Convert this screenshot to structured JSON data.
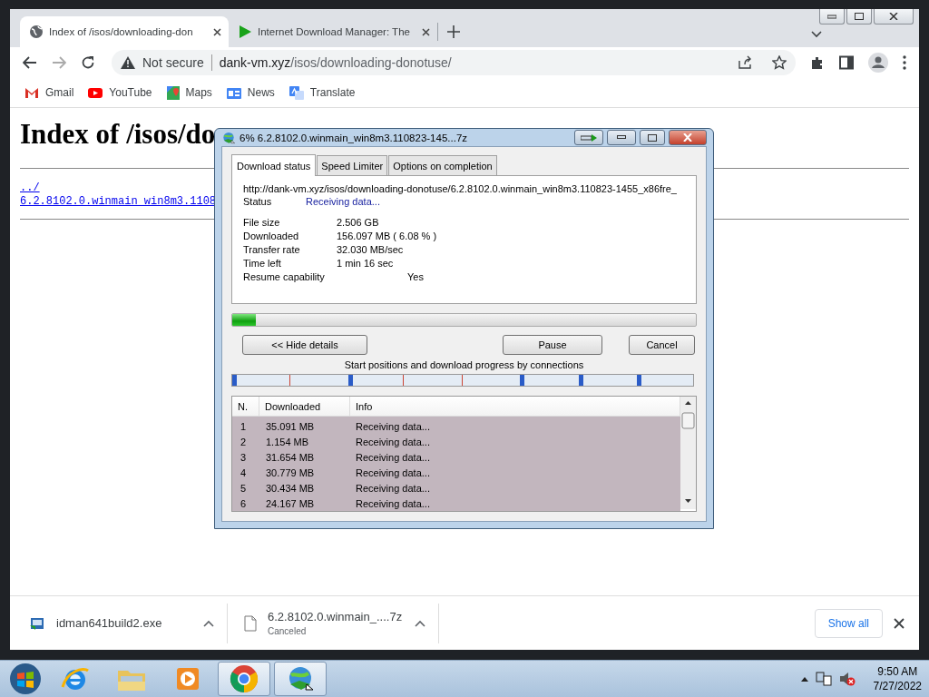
{
  "browser": {
    "tabs": [
      {
        "title": "Index of /isos/downloading-don",
        "selected": true,
        "kind": "globe"
      },
      {
        "title": "Internet Download Manager: The",
        "selected": false,
        "kind": "idm"
      }
    ],
    "address": {
      "security": "Not secure",
      "host": "dank-vm.xyz",
      "path": "/isos/downloading-donotuse/"
    },
    "bookmarks": [
      {
        "label": "Gmail",
        "kind": "gmail"
      },
      {
        "label": "YouTube",
        "kind": "youtube"
      },
      {
        "label": "Maps",
        "kind": "maps"
      },
      {
        "label": "News",
        "kind": "news"
      },
      {
        "label": "Translate",
        "kind": "translate"
      }
    ]
  },
  "page": {
    "heading": "Index of /isos/do",
    "links": [
      "../",
      "6.2.8102.0.winmain_win8m3.1108"
    ]
  },
  "dialog": {
    "title": "6% 6.2.8102.0.winmain_win8m3.110823-145...7z",
    "tabs": [
      {
        "label": "Download status",
        "selected": true
      },
      {
        "label": "Speed Limiter",
        "selected": false
      },
      {
        "label": "Options on completion",
        "selected": false
      }
    ],
    "url": "http://dank-vm.xyz/isos/downloading-donotuse/6.2.8102.0.winmain_win8m3.110823-1455_x86fre_",
    "status": {
      "label": "Status",
      "value": "Receiving data..."
    },
    "details": [
      {
        "label": "File size",
        "value": "2.506  GB"
      },
      {
        "label": "Downloaded",
        "value": "156.097  MB  ( 6.08 % )"
      },
      {
        "label": "Transfer rate",
        "value": "32.030  MB/sec"
      },
      {
        "label": "Time left",
        "value": "1 min  16 sec"
      },
      {
        "label": "Resume capability",
        "value": "Yes"
      }
    ],
    "progress": {
      "level": 0.05
    },
    "buttons": [
      "<< Hide details",
      "Pause",
      "Cancel"
    ],
    "connections_label": "Start positions and download progress by connections",
    "table": {
      "columns": [
        "N.",
        "Downloaded",
        "Info"
      ],
      "rows": [
        [
          "1",
          "35.091  MB",
          "Receiving data..."
        ],
        [
          "2",
          "1.154  MB",
          "Receiving data..."
        ],
        [
          "3",
          "31.654  MB",
          "Receiving data..."
        ],
        [
          "4",
          "30.779  MB",
          "Receiving data..."
        ],
        [
          "5",
          "30.434  MB",
          "Receiving data..."
        ],
        [
          "6",
          "24.167  MB",
          "Receiving data..."
        ]
      ]
    }
  },
  "downloads": {
    "items": [
      {
        "name": "idman641build2.exe",
        "kind": "installer"
      },
      {
        "name": "6.2.8102.0.winmain_....7z",
        "status": "Canceled",
        "kind": "file"
      }
    ],
    "show_all": "Show all"
  },
  "taskbar": {
    "apps": [
      {
        "kind": "ie",
        "active": false
      },
      {
        "kind": "explorer",
        "active": false
      },
      {
        "kind": "media",
        "active": false
      },
      {
        "kind": "chrome",
        "active": true
      },
      {
        "kind": "idm",
        "active": true
      }
    ],
    "clock": {
      "time": "9:50 AM",
      "date": "7/27/2022"
    }
  }
}
